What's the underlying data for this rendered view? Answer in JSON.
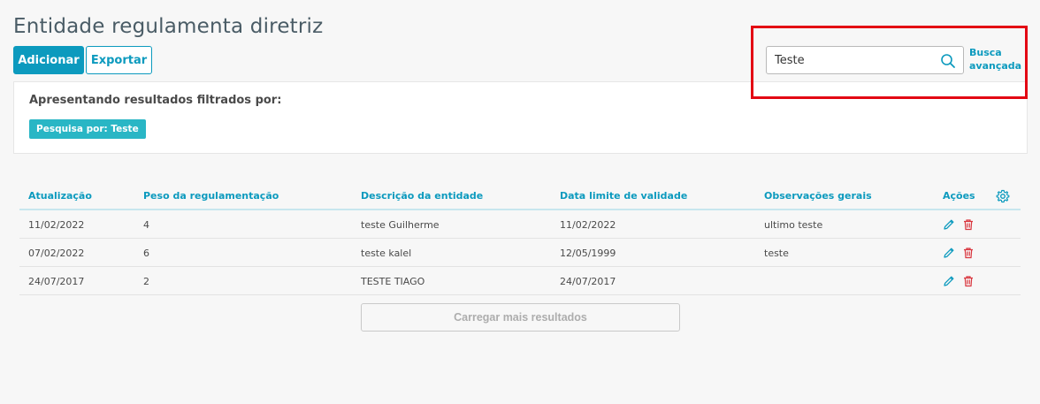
{
  "page": {
    "title": "Entidade regulamenta diretriz"
  },
  "toolbar": {
    "add_label": "Adicionar",
    "export_label": "Exportar"
  },
  "search": {
    "value": "Teste",
    "icon": "search-icon",
    "advanced_line1": "Busca",
    "advanced_line2": "avançada"
  },
  "filters": {
    "heading": "Apresentando resultados filtrados por:",
    "chip": "Pesquisa por: Teste"
  },
  "table": {
    "columns": [
      "Atualização",
      "Peso da regulamentação",
      "Descrição da entidade",
      "Data limite de validade",
      "Observações gerais",
      "Ações"
    ],
    "rows": [
      [
        "11/02/2022",
        "4",
        "teste Guilherme",
        "11/02/2022",
        "ultimo teste"
      ],
      [
        "07/02/2022",
        "6",
        "teste kalel",
        "12/05/1999",
        "teste"
      ],
      [
        "24/07/2017",
        "2",
        "TESTE TIAGO",
        "24/07/2017",
        ""
      ]
    ]
  },
  "load_more_label": "Carregar mais resultados",
  "colors": {
    "accent": "#0c9abe",
    "chip": "#29b6c5",
    "delete": "#d9363e",
    "highlight": "#e30613"
  }
}
